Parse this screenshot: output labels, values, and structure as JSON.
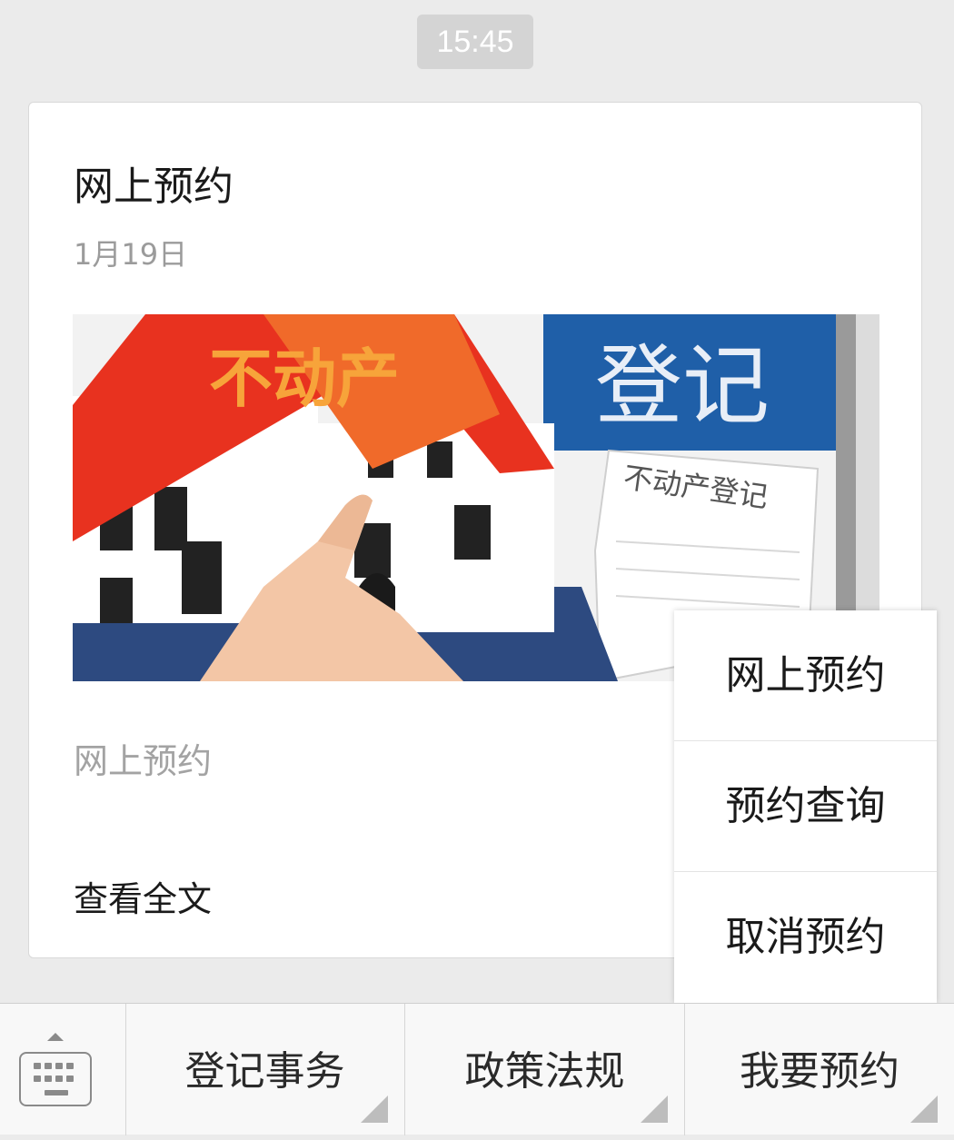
{
  "time": "15:45",
  "card": {
    "title": "网上预约",
    "date": "1月19日",
    "image_alt": "不动产登记",
    "image_sign_text": "登记",
    "image_roof_text": "不动产",
    "image_paper_text": "不动产登记",
    "summary": "网上预约",
    "read_more": "查看全文"
  },
  "popup": {
    "items": [
      {
        "label": "网上预约"
      },
      {
        "label": "预约查询"
      },
      {
        "label": "取消预约"
      }
    ]
  },
  "bottom_menu": {
    "items": [
      {
        "label": "登记事务"
      },
      {
        "label": "政策法规"
      },
      {
        "label": "我要预约"
      }
    ]
  },
  "colors": {
    "background": "#ebebeb",
    "card": "#ffffff",
    "roof": "#e8321f",
    "sign_blue": "#1f5fa8"
  },
  "icons": [
    "keyboard-icon",
    "expand-up-icon",
    "submenu-corner-icon"
  ]
}
